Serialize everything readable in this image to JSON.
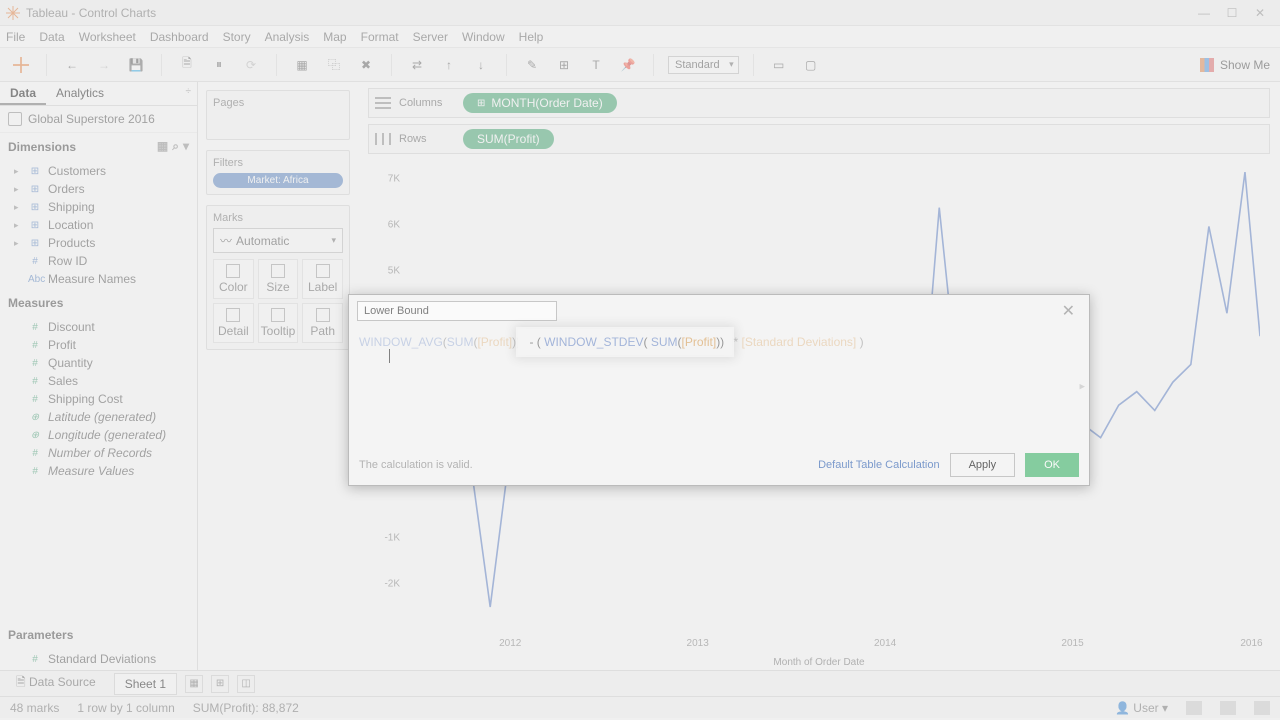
{
  "titlebar": {
    "app": "Tableau",
    "doc": "Control Charts"
  },
  "menu": [
    "File",
    "Data",
    "Worksheet",
    "Dashboard",
    "Story",
    "Analysis",
    "Map",
    "Format",
    "Server",
    "Window",
    "Help"
  ],
  "toolbar": {
    "fit": "Standard",
    "showme": "Show Me"
  },
  "data_tabs": {
    "data": "Data",
    "analytics": "Analytics"
  },
  "datasource": "Global Superstore 2016",
  "dimensions": {
    "title": "Dimensions",
    "items": [
      "Customers",
      "Orders",
      "Shipping",
      "Location",
      "Products",
      "Row ID",
      "Measure Names"
    ]
  },
  "measures": {
    "title": "Measures",
    "items": [
      "Discount",
      "Profit",
      "Quantity",
      "Sales",
      "Shipping Cost",
      "Latitude (generated)",
      "Longitude (generated)",
      "Number of Records",
      "Measure Values"
    ]
  },
  "parameters": {
    "title": "Parameters",
    "items": [
      "Standard Deviations"
    ]
  },
  "cards": {
    "pages": "Pages",
    "filters": "Filters",
    "filter_pill": "Market: Africa",
    "marks": "Marks",
    "marks_type": "Automatic",
    "cells": [
      "Color",
      "Size",
      "Label",
      "Detail",
      "Tooltip",
      "Path"
    ]
  },
  "shelves": {
    "columns": "Columns",
    "columns_pill": "MONTH(Order Date)",
    "rows": "Rows",
    "rows_pill": "SUM(Profit)"
  },
  "chart": {
    "y_ticks": [
      "7K",
      "6K",
      "5K",
      "-1K",
      "-2K"
    ],
    "x_ticks": [
      "2012",
      "2013",
      "2014",
      "2015",
      "2016"
    ],
    "x_title": "Month of Order Date"
  },
  "chart_data": {
    "type": "line",
    "title": "",
    "xlabel": "Month of Order Date",
    "ylabel": "SUM(Profit)",
    "ylim": [
      -3000,
      7000
    ],
    "x": [
      "2012-01",
      "2012-02",
      "2012-03",
      "2012-04",
      "2012-05",
      "2012-06",
      "2012-07",
      "2012-08",
      "2012-09",
      "2012-10",
      "2012-11",
      "2012-12",
      "2013-01",
      "2013-02",
      "2013-03",
      "2013-04",
      "2013-05",
      "2013-06",
      "2013-07",
      "2013-08",
      "2013-09",
      "2013-10",
      "2013-11",
      "2013-12",
      "2014-01",
      "2014-02",
      "2014-03",
      "2014-04",
      "2014-05",
      "2014-06",
      "2014-07",
      "2014-08",
      "2014-09",
      "2014-10",
      "2014-11",
      "2014-12",
      "2015-01",
      "2015-02",
      "2015-03",
      "2015-04",
      "2015-05",
      "2015-06",
      "2015-07",
      "2015-08",
      "2015-09",
      "2015-10",
      "2015-11",
      "2015-12"
    ],
    "series": [
      {
        "name": "SUM(Profit)",
        "values": [
          1400,
          900,
          700,
          400,
          -2500,
          600,
          900,
          1100,
          1000,
          1200,
          1500,
          2200,
          700,
          400,
          1300,
          1000,
          900,
          1200,
          1700,
          1500,
          1800,
          2100,
          1800,
          2200,
          900,
          1400,
          1800,
          1700,
          1400,
          6200,
          2400,
          1300,
          1800,
          2800,
          2100,
          2800,
          900,
          1500,
          1200,
          1900,
          2200,
          1800,
          2400,
          2800,
          5800,
          3900,
          7000,
          3400
        ]
      }
    ]
  },
  "calc": {
    "name": "Lower Bound",
    "formula_parts": {
      "f1": "WINDOW_AVG",
      "p1": "(",
      "f2": "SUM",
      "p2": "(",
      "fld1": "[Profit]",
      "p3": "))",
      "op1": " - ( ",
      "f3": "WINDOW_STDEV",
      "p4": "( ",
      "f4": "SUM",
      "p5": "(",
      "fld2": "[Profit]",
      "p6": "))",
      "op2": " * ",
      "fld3": "[Standard Deviations]",
      "p7": " )"
    },
    "valid": "The calculation is valid.",
    "link": "Default Table Calculation",
    "apply": "Apply",
    "ok": "OK"
  },
  "tabs": {
    "ds": "Data Source",
    "sheet": "Sheet 1"
  },
  "status": {
    "marks": "48 marks",
    "rows": "1 row by 1 column",
    "sum": "SUM(Profit): 88,872",
    "user": "User"
  }
}
